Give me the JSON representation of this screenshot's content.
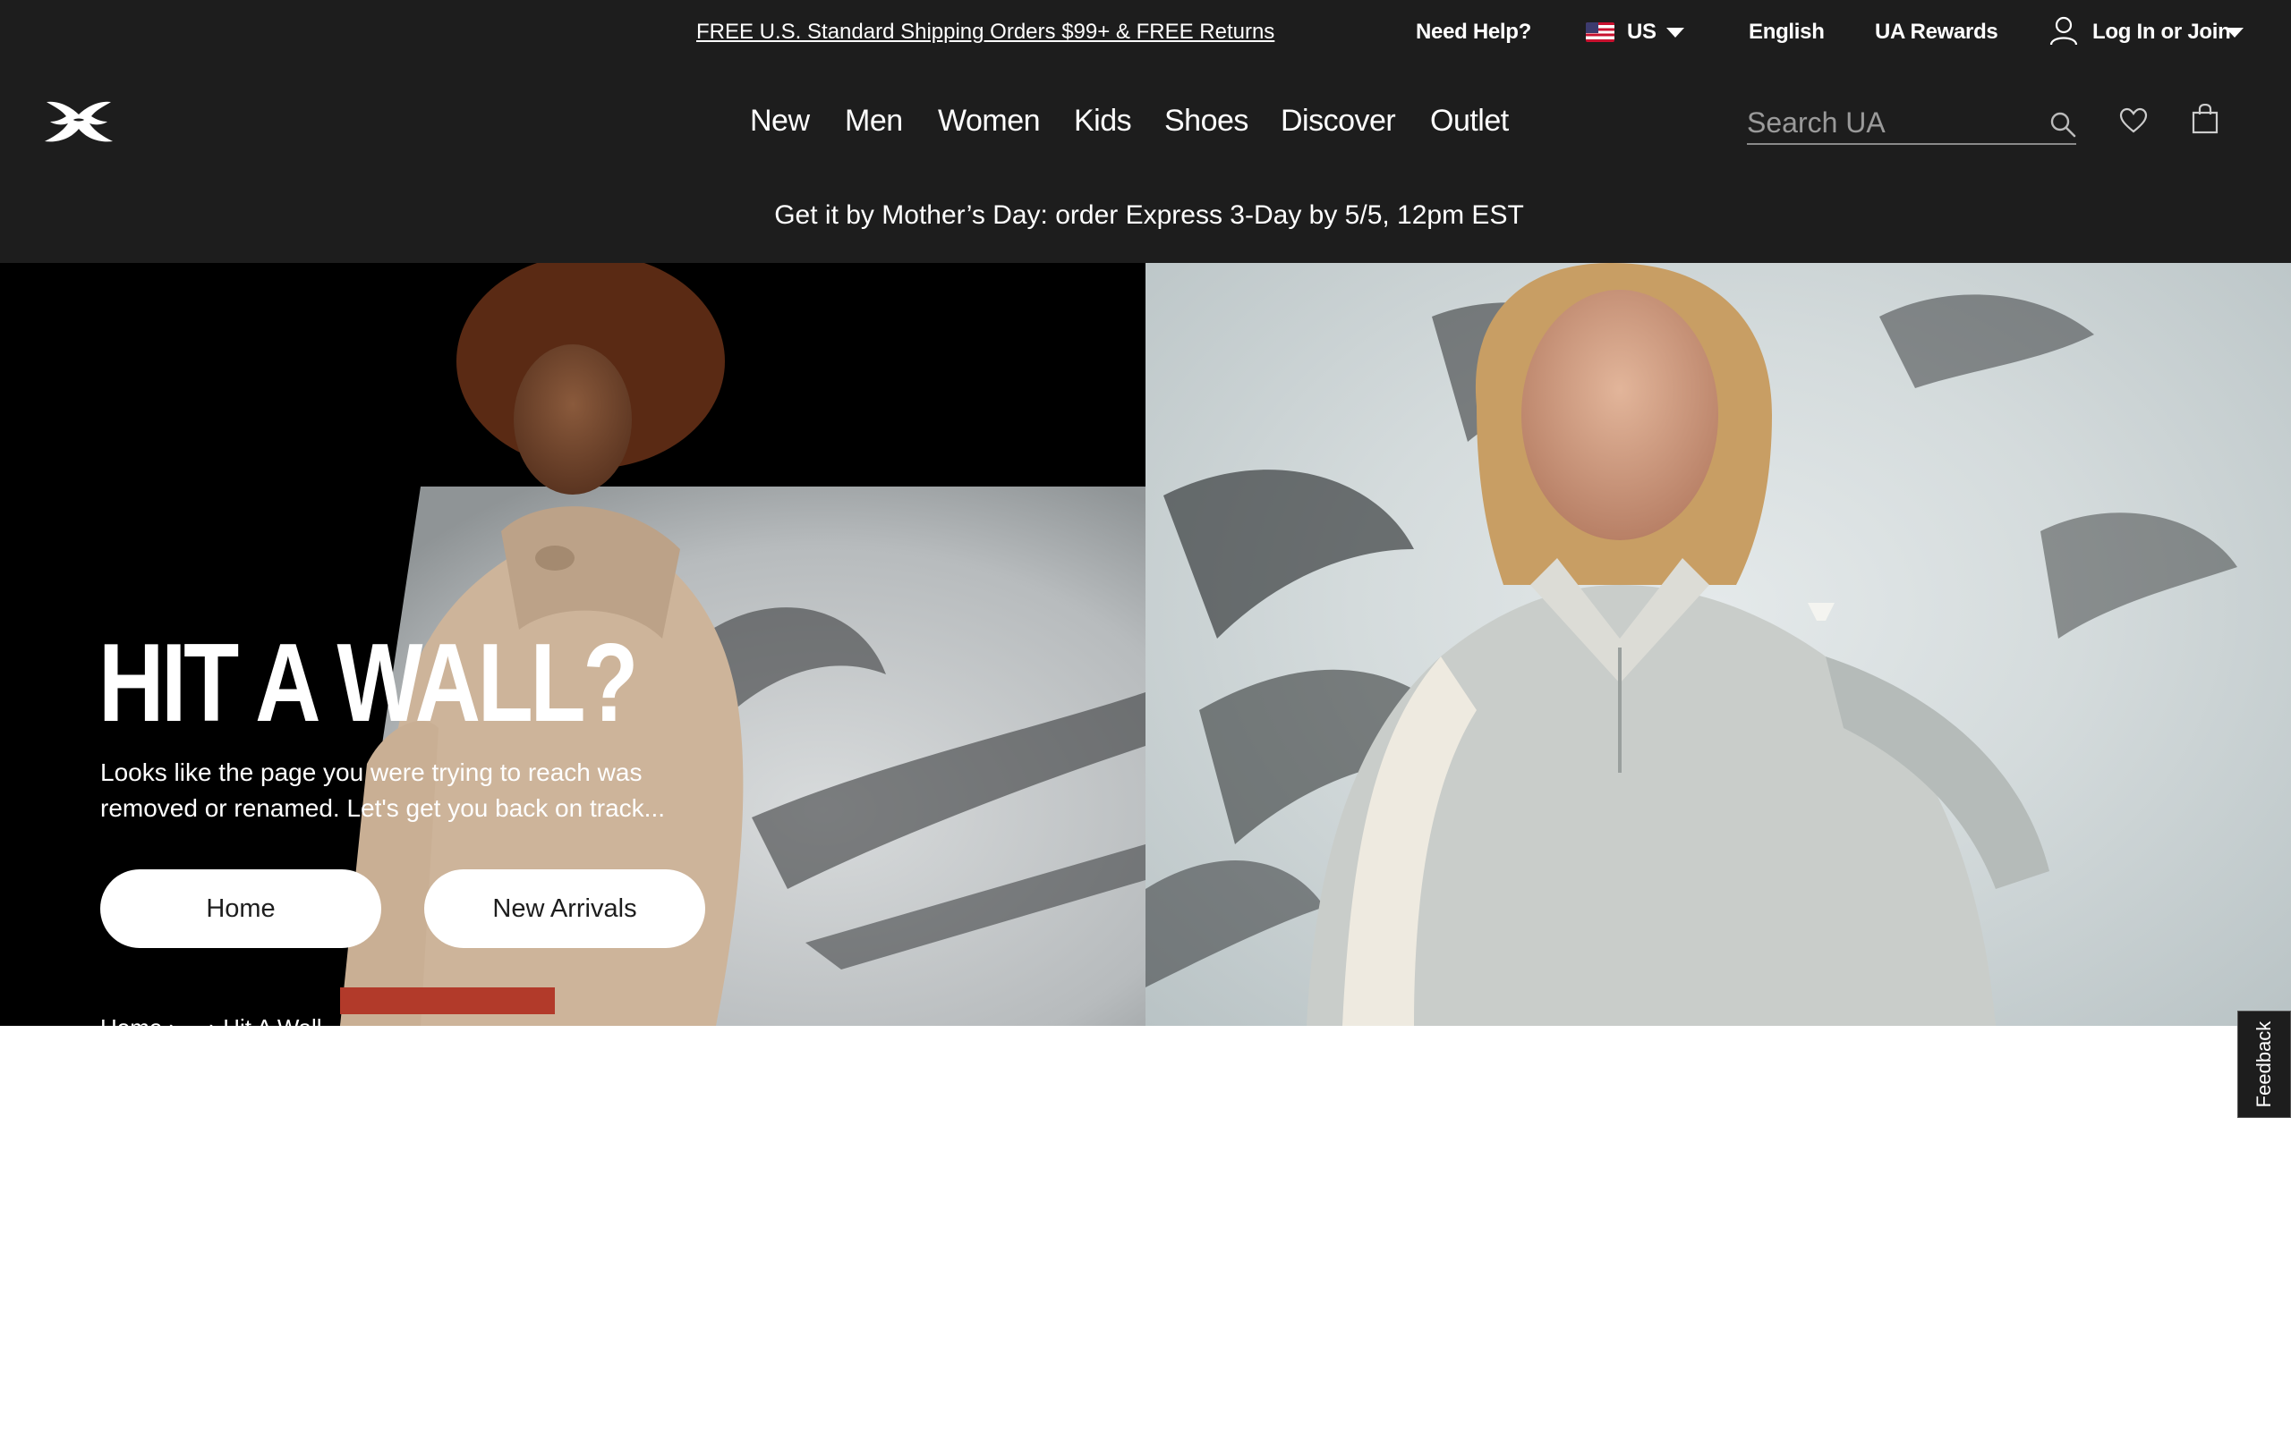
{
  "utility_bar": {
    "promo": "FREE U.S. Standard Shipping Orders $99+ & FREE Returns",
    "need_help": "Need Help?",
    "country": "US",
    "language": "English",
    "rewards": "UA Rewards",
    "login": "Log In or Join"
  },
  "nav": {
    "items": [
      "New",
      "Men",
      "Women",
      "Kids",
      "Shoes",
      "Discover",
      "Outlet"
    ],
    "search_placeholder": "Search UA"
  },
  "banner": {
    "text": "Get it by Mother’s Day: order Express 3-Day by 5/5, 12pm EST"
  },
  "hero": {
    "headline": "HIT A WALL?",
    "subtext": "Looks like the page you were trying to reach was removed or renamed. Let's get you back on track...",
    "buttons": [
      "Home",
      "New Arrivals"
    ],
    "breadcrumb": "Home  ›  ...  ›  Hit A Wall"
  },
  "feedback": {
    "label": "Feedback"
  },
  "colors": {
    "header_bg": "#1d1d1d",
    "button_bg": "#ffffff",
    "button_text": "#1d1d1d",
    "page_bg": "#ffffff"
  },
  "icons": [
    "ua-logo-icon",
    "flag-us-icon",
    "chevron-down-icon",
    "user-icon",
    "search-icon",
    "heart-icon",
    "bag-icon"
  ]
}
